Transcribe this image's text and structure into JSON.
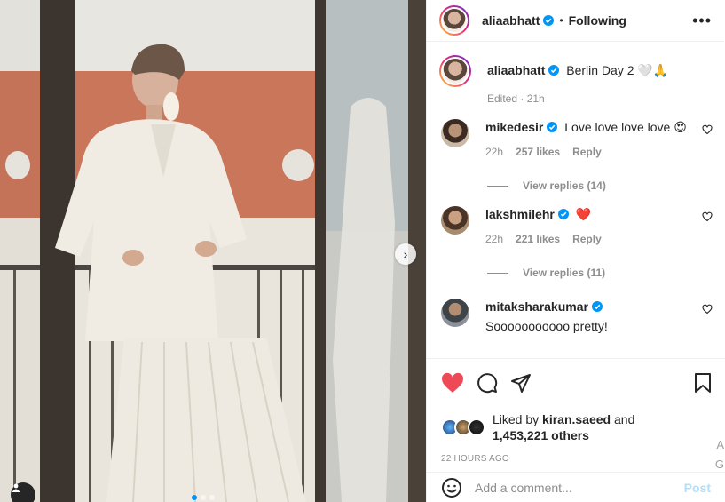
{
  "post": {
    "author": "aliaabhatt",
    "follow_separator": "•",
    "follow_state": "Following",
    "more_icon": "more-horizontal-icon"
  },
  "caption": {
    "username": "aliaabhatt",
    "text": "Berlin Day 2 🤍🙏",
    "edited": "Edited · 21h"
  },
  "comments": [
    {
      "username": "mikedesir",
      "text": "Love love love love 😍",
      "time": "22h",
      "likes": "257 likes",
      "reply": "Reply",
      "view_replies": "View replies (14)"
    },
    {
      "username": "lakshmilehr",
      "text": "❤️",
      "time": "22h",
      "likes": "221 likes",
      "reply": "Reply",
      "view_replies": "View replies (11)"
    },
    {
      "username": "mitaksharakumar",
      "text": "Sooooooooooo pretty!"
    }
  ],
  "likes": {
    "prefix": "Liked by",
    "user": "kiran.saeed",
    "and": "and",
    "others": "1,453,221 others"
  },
  "timestamp": "22 HOURS AGO",
  "composer": {
    "placeholder": "Add a comment...",
    "post_label": "Post"
  },
  "edge_overflow": {
    "line1": "A",
    "line2": "G"
  },
  "colors": {
    "like_red": "#ed4956",
    "verified_blue": "#0095f6",
    "post_disabled": "#b2dffc",
    "muted": "#8e8e8e"
  },
  "icons": [
    "heart-filled-icon",
    "comment-icon",
    "share-icon",
    "bookmark-icon",
    "emoji-icon",
    "chevron-right-icon",
    "user-tag-icon",
    "verified-badge-icon"
  ]
}
